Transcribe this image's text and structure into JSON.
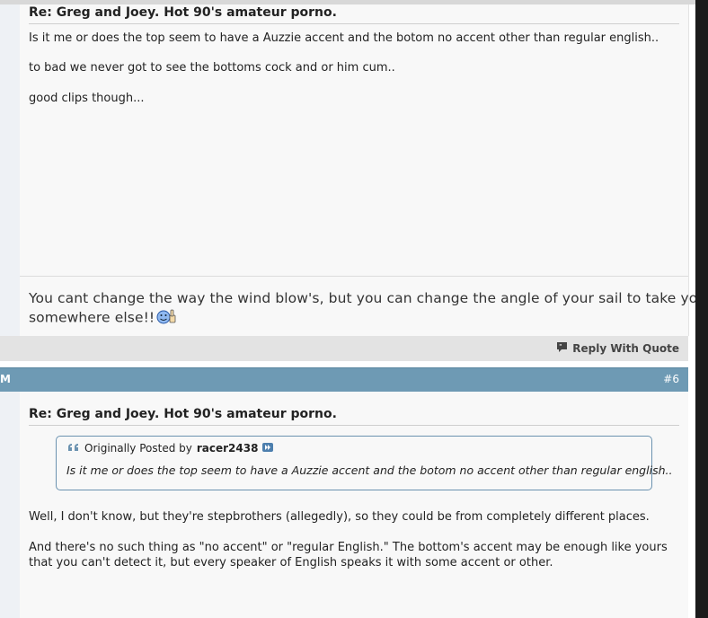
{
  "post_prev": {
    "title": "Re: Greg and Joey. Hot 90's amateur porno.",
    "body_lines": [
      "Is it me or does the top seem to have a Auzzie accent and the botom no accent other than regular english..",
      "to bad we never got to see the bottoms cock and or him cum..",
      "good clips though..."
    ],
    "signature_lines": [
      "You cant change the way the wind blow's, but you can change the angle of your sail to take you",
      "somewhere else!!"
    ],
    "reply_label": "Reply With Quote"
  },
  "post_current": {
    "header_left": "M",
    "post_number": "#6",
    "title": "Re: Greg and Joey. Hot 90's amateur porno.",
    "quote": {
      "prefix": "Originally Posted by",
      "author": "racer2438",
      "text": "Is it me or does the top seem to have a Auzzie accent and the botom no accent other than regular english.."
    },
    "body_lines": [
      "Well, I don't know, but they're stepbrothers (allegedly), so they could be from completely different places.",
      "And there's no such thing as \"no accent\" or \"regular English.\" The bottom's accent may be enough like yours",
      "that you can't detect it, but every speaker of English speaks it with some accent or other."
    ]
  },
  "colors": {
    "header_bar": "#6e9ab4",
    "quote_border": "#6b92b0",
    "post_bg": "#f8f8f8"
  },
  "icons": {
    "reply": "speech-bubble-quote-icon",
    "quote": "double-quote-icon",
    "goto_post": "view-post-arrow-icon",
    "smiley": "thumbs-up-smiley-icon"
  }
}
